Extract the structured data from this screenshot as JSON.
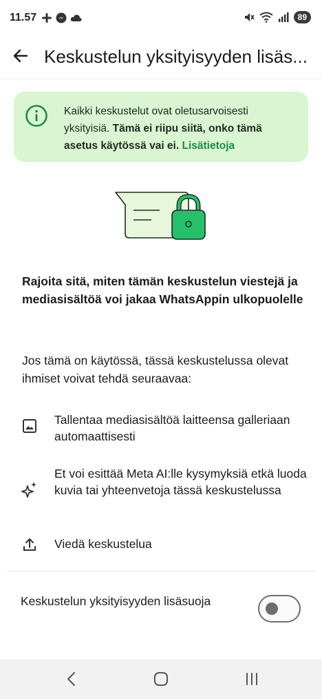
{
  "status_bar": {
    "time": "11.57",
    "left_icons": [
      "slack-icon",
      "messenger-icon",
      "cloud-icon"
    ],
    "right_icons": [
      "mute-icon",
      "wifi-icon",
      "signal-icon"
    ],
    "battery": "89"
  },
  "app_bar": {
    "title": "Keskustelun yksityisyyden lisäs..."
  },
  "info_card": {
    "text_plain": "Kaikki keskustelut ovat oletusarvoisesti yksityisiä. ",
    "text_bold": "Tämä ei riipu siitä, onko tämä asetus käytössä vai ei.",
    "link": "Lisätietoja"
  },
  "heading": "Rajoita sitä, miten tämän keskustelun viestejä ja mediasisältöä voi jakaa WhatsAppin ulkopuolelle",
  "intro": "Jos tämä on käytössä, tässä keskustelussa olevat ihmiset voivat tehdä seuraavaa:",
  "features": [
    {
      "icon": "image-icon",
      "text": "Tallentaa mediasisältöä laitteensa galleriaan automaattisesti"
    },
    {
      "icon": "sparkle-icon",
      "text": "Et voi esittää Meta AI:lle kysymyksiä etkä luoda kuvia tai yhteenvetoja tässä keskustelussa"
    },
    {
      "icon": "upload-icon",
      "text": "Viedä keskustelua"
    }
  ],
  "setting": {
    "label": "Keskustelun yksityisyyden lisäsuoja",
    "enabled": false
  },
  "colors": {
    "accent_green": "#1b8a4b",
    "card_bg": "#d9f5d2",
    "illustration_green": "#25c16a",
    "illustration_light": "#e8f7dc"
  }
}
